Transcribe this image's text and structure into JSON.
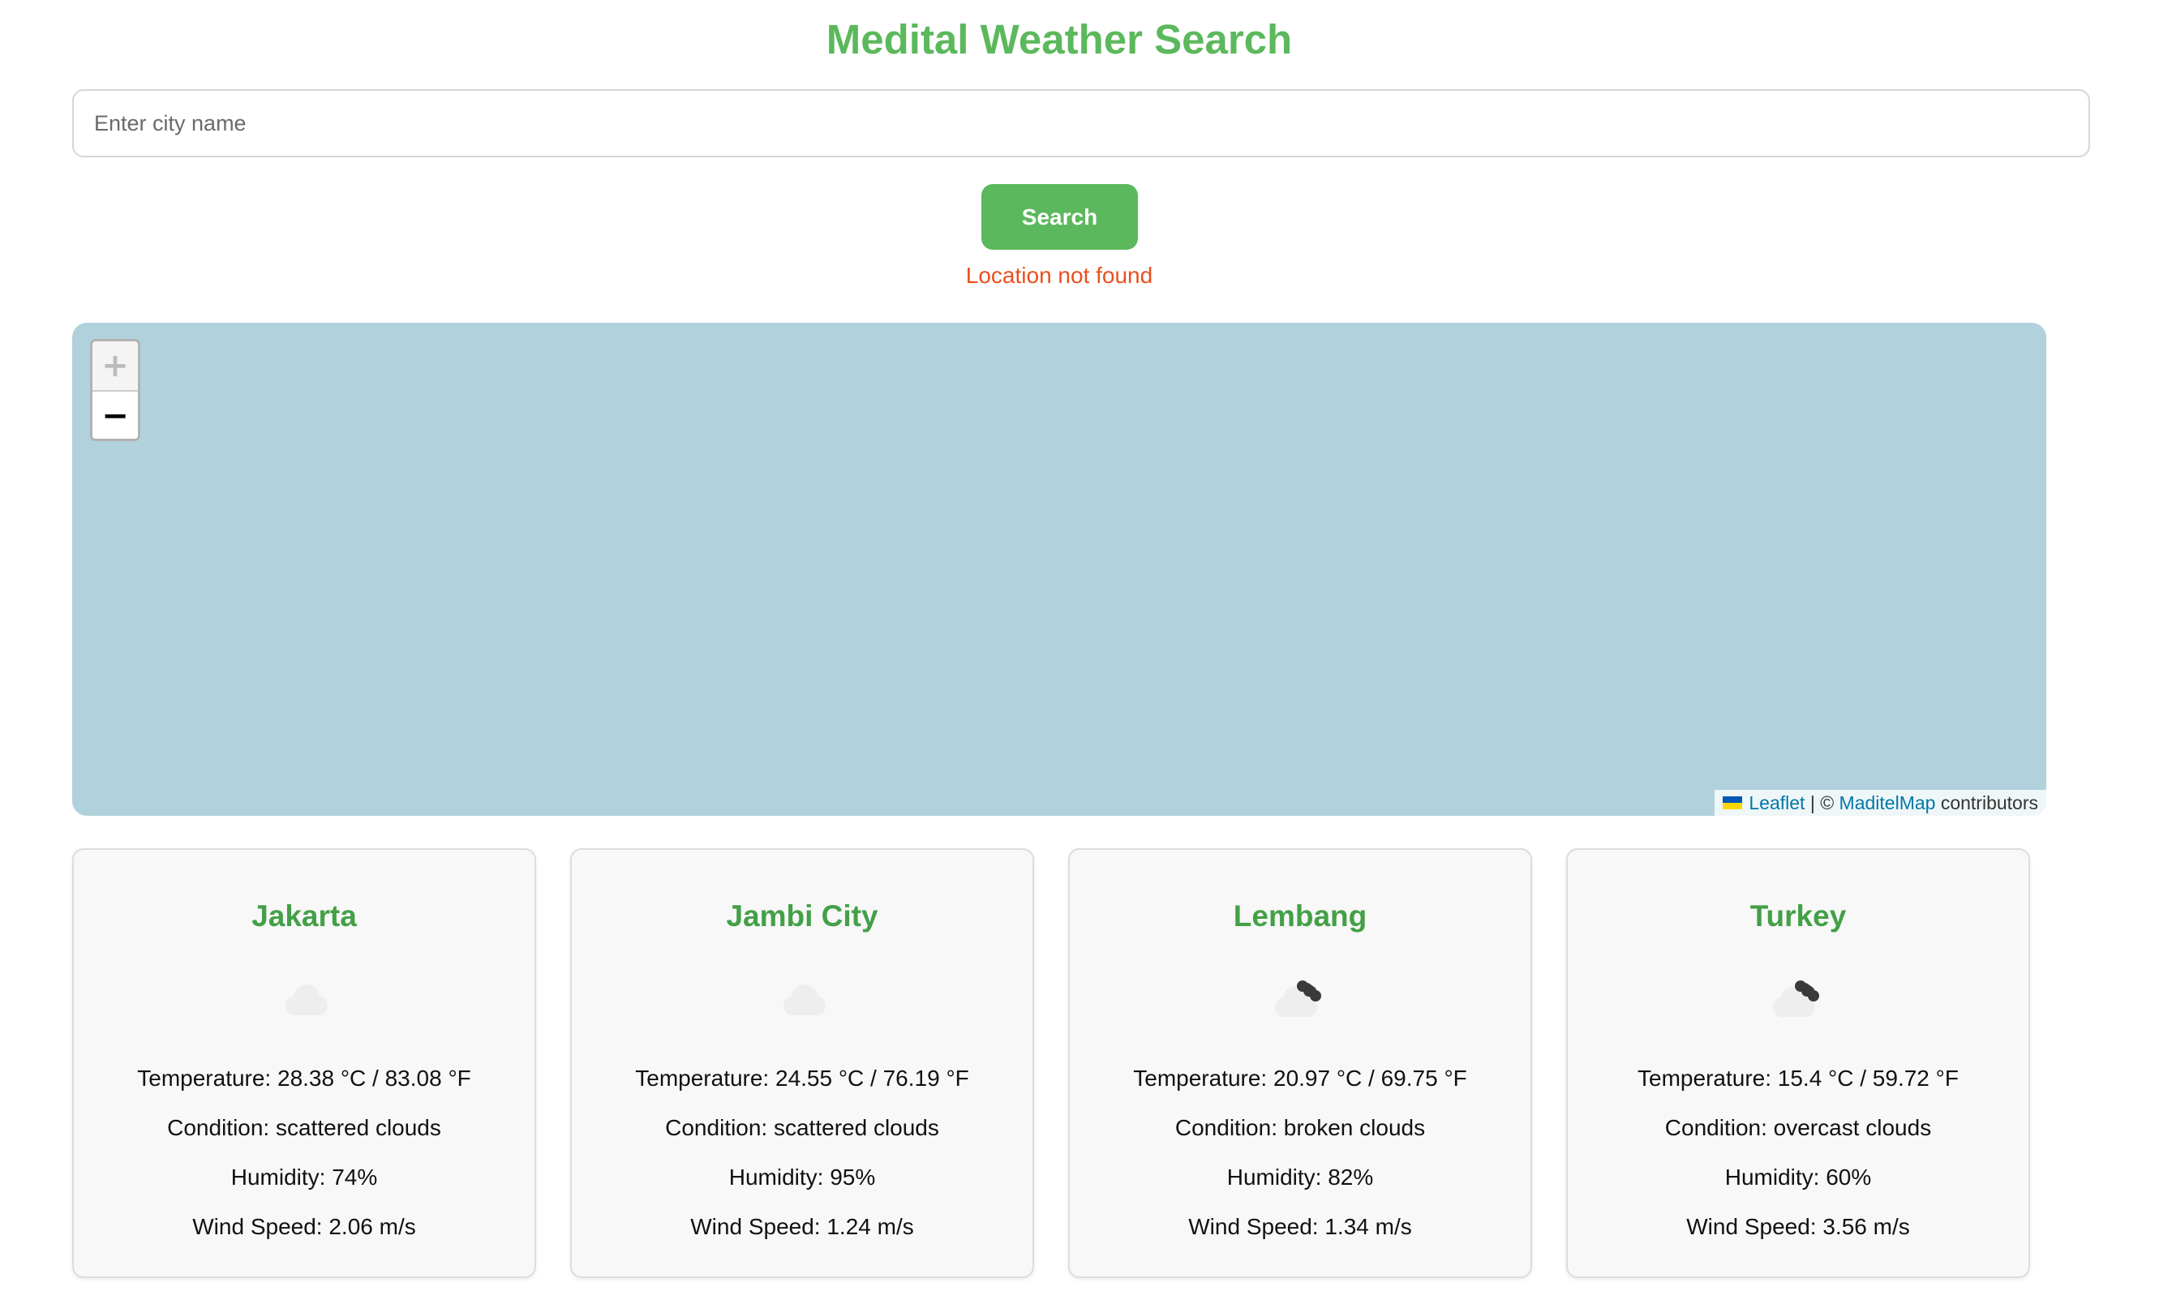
{
  "header": {
    "title": "Medital Weather Search"
  },
  "search": {
    "placeholder": "Enter city name",
    "value": "",
    "button_label": "Search",
    "error_message": "Location not found"
  },
  "map": {
    "zoom_in_label": "+",
    "zoom_out_label": "−",
    "attribution": {
      "leaflet_link": "Leaflet",
      "separator": " | © ",
      "provider_link": "MaditelMap",
      "suffix": " contributors"
    },
    "background_color": "#b1d2dc"
  },
  "cards": [
    {
      "city": "Jakarta",
      "icon": "scattered-clouds-icon",
      "temperature": "Temperature: 28.38 °C / 83.08 °F",
      "condition": "Condition: scattered clouds",
      "humidity": "Humidity: 74%",
      "wind": "Wind Speed: 2.06 m/s"
    },
    {
      "city": "Jambi City",
      "icon": "scattered-clouds-icon",
      "temperature": "Temperature: 24.55 °C / 76.19 °F",
      "condition": "Condition: scattered clouds",
      "humidity": "Humidity: 95%",
      "wind": "Wind Speed: 1.24 m/s"
    },
    {
      "city": "Lembang",
      "icon": "broken-clouds-icon",
      "temperature": "Temperature: 20.97 °C / 69.75 °F",
      "condition": "Condition: broken clouds",
      "humidity": "Humidity: 82%",
      "wind": "Wind Speed: 1.34 m/s"
    },
    {
      "city": "Turkey",
      "icon": "overcast-clouds-icon",
      "temperature": "Temperature: 15.4 °C / 59.72 °F",
      "condition": "Condition: overcast clouds",
      "humidity": "Humidity: 60%",
      "wind": "Wind Speed: 3.56 m/s"
    }
  ],
  "colors": {
    "accent": "#5cb85c",
    "city_title": "#43a047",
    "error": "#e8501f",
    "link": "#0078a8"
  }
}
